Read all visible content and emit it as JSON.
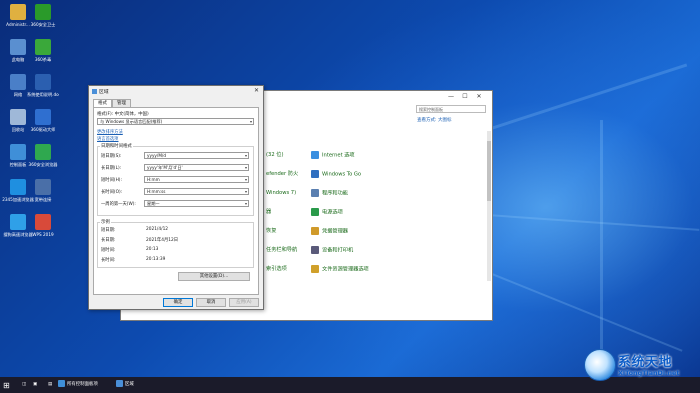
{
  "desktop": {
    "icons": [
      {
        "label": "Administr...",
        "icon": "user-folder-icon",
        "color": "#e0b040"
      },
      {
        "label": "360安全卫士",
        "icon": "shield-360-icon",
        "color": "#2a9a2a"
      },
      {
        "label": "此电脑",
        "icon": "computer-icon",
        "color": "#5a8fd0"
      },
      {
        "label": "360杀毒",
        "icon": "antivirus-360-icon",
        "color": "#3aa83a"
      },
      {
        "label": "网络",
        "icon": "network-icon",
        "color": "#4a7fc8"
      },
      {
        "label": "系统使用说明.docx",
        "icon": "docx-icon",
        "color": "#2b5fb0"
      },
      {
        "label": "回收站",
        "icon": "recycle-bin-icon",
        "color": "#9fb8d8"
      },
      {
        "label": "360驱动大师",
        "icon": "driver-360-icon",
        "color": "#2f6fd0"
      },
      {
        "label": "控制面板",
        "icon": "control-panel-icon",
        "color": "#3f8fd8"
      },
      {
        "label": "360安全浏览器",
        "icon": "browser-360-icon",
        "color": "#2fa84f"
      },
      {
        "label": "2345加速浏览器",
        "icon": "browser-2345-icon",
        "color": "#1f8fe0"
      },
      {
        "label": "宽带连接",
        "icon": "broadband-icon",
        "color": "#4a6fa8"
      },
      {
        "label": "搜狗高速浏览器",
        "icon": "sogou-browser-icon",
        "color": "#2fa0e8"
      },
      {
        "label": "WPS 2019",
        "icon": "wps-icon",
        "color": "#d84a3a"
      }
    ]
  },
  "panel": {
    "search_placeholder": "搜索控制面板",
    "view_mode": "查看方式: 大图标",
    "items": [
      {
        "label": "(32 位)",
        "color": "#3a7fd0"
      },
      {
        "label": "Internet 选项",
        "color": "#3a8fe0"
      },
      {
        "label": "efender 防火",
        "color": "#d0662a"
      },
      {
        "label": "Windows To Go",
        "color": "#2f6fc0"
      },
      {
        "label": "Windows 7)",
        "color": "#3a7fd0"
      },
      {
        "label": "程序和功能",
        "color": "#5a7fb0"
      },
      {
        "label": "器",
        "color": "#6a8fc0"
      },
      {
        "label": "电源选项",
        "color": "#2a9a4a"
      },
      {
        "label": "恢复",
        "color": "#3a7fd0"
      },
      {
        "label": "凭据管理器",
        "color": "#d09a2a"
      },
      {
        "label": "任务栏和导航",
        "color": "#4a6fa8"
      },
      {
        "label": "设备和打印机",
        "color": "#5a5a7a"
      },
      {
        "label": "索引选项",
        "color": "#8a8aa8"
      },
      {
        "label": "文件资源管理器选项",
        "color": "#d0a02a"
      }
    ]
  },
  "dialog": {
    "title": "区域",
    "tabs": [
      "格式",
      "管理"
    ],
    "format_label": "格式(F): 中文(简体，中国)",
    "format_value": "与 Windows 显示语言匹配(推荐)",
    "language_pref_link": "更改排序方法",
    "language_link": "语言首选项",
    "group_title": "日期和时间格式",
    "rows": [
      {
        "label": "短日期(S):",
        "value": "yyyy/M/d"
      },
      {
        "label": "长日期(L):",
        "value": "yyyy'年'M'月'd'日'"
      },
      {
        "label": "短时间(H):",
        "value": "H:mm"
      },
      {
        "label": "长时间(O):",
        "value": "H:mm:ss"
      },
      {
        "label": "一周的第一天(W):",
        "value": "星期一"
      }
    ],
    "example_title": "示例",
    "examples": [
      {
        "label": "短日期:",
        "value": "2021/4/12"
      },
      {
        "label": "长日期:",
        "value": "2021年4月12日"
      },
      {
        "label": "短时间:",
        "value": "20:13"
      },
      {
        "label": "长时间:",
        "value": "20:13:39"
      }
    ],
    "other_settings": "其他设置(D)...",
    "ok": "确定",
    "cancel": "取消",
    "apply": "应用(A)"
  },
  "taskbar": {
    "start_icon": "windows-logo-icon",
    "items": [
      {
        "label": "所有控制面板项",
        "icon": "control-panel-icon"
      },
      {
        "label": "区域",
        "icon": "region-icon"
      }
    ]
  },
  "watermark": {
    "title": "系统天地",
    "url": "XiTongTianDi.net"
  }
}
